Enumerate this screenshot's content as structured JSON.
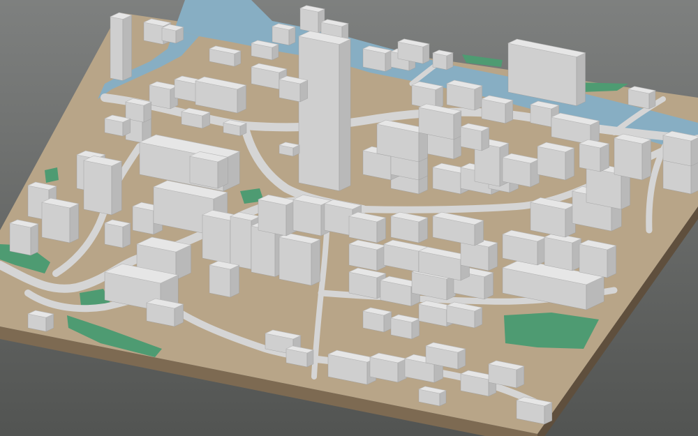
{
  "view": {
    "subject": "3d-city-block-model",
    "colors": {
      "background_top": "#7e807f",
      "background_bottom": "#525452",
      "terrain": "#b8a588",
      "terrain_edge": "#7d6a52",
      "terrain_edge_dark": "#5f4f3d",
      "road": "#d5d5d5",
      "water": "#87aec3",
      "park": "#4e9b72",
      "building_top": "#e6e6e6",
      "building_left": "#cfcfcf",
      "building_right": "#b9b9b9"
    }
  }
}
